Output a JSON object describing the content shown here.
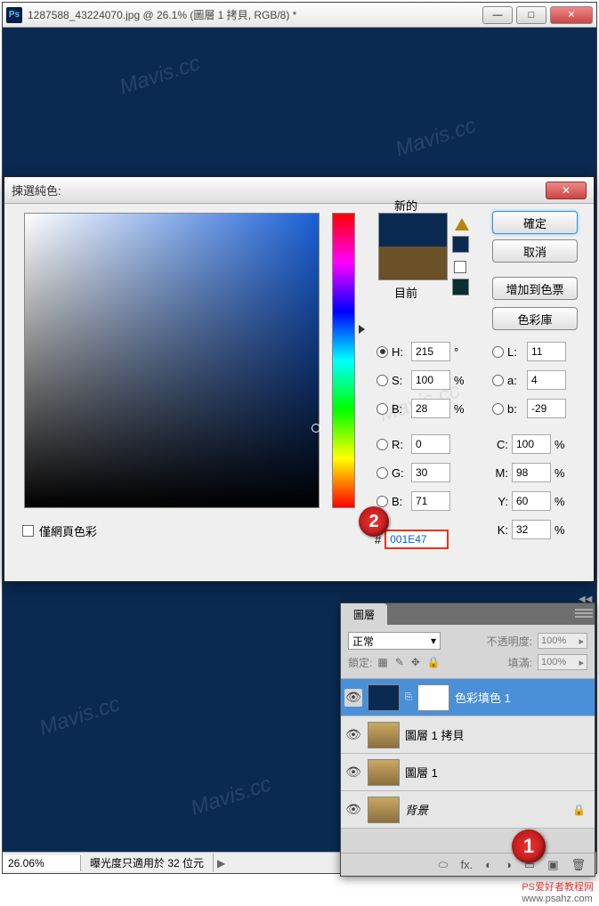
{
  "window": {
    "title": "1287588_43224070.jpg @ 26.1% (圖層 1 拷貝, RGB/8) *",
    "ps_label": "Ps"
  },
  "statusbar": {
    "zoom": "26.06%",
    "info": "曝光度只適用於 32 位元"
  },
  "color_dialog": {
    "title": "揀選純色:",
    "labels": {
      "new": "新的",
      "current": "目前"
    },
    "buttons": {
      "ok": "確定",
      "cancel": "取消",
      "add": "增加到色票",
      "lib": "色彩庫"
    },
    "hsb": {
      "H": "215",
      "S": "100",
      "B": "28"
    },
    "lab": {
      "L": "11",
      "a": "4",
      "b": "-29"
    },
    "rgb": {
      "R": "0",
      "G": "30",
      "B": "71"
    },
    "cmyk": {
      "C": "100",
      "M": "98",
      "Y": "60",
      "K": "32"
    },
    "units": {
      "deg": "°",
      "pct": "%"
    },
    "hex_prefix": "#",
    "hex": "001E47",
    "web_only": "僅網頁色彩"
  },
  "layers": {
    "tab": "圖層",
    "blend_mode": "正常",
    "opacity_label": "不透明度:",
    "opacity": "100%",
    "lock_label": "鎖定:",
    "fill_label": "填滿:",
    "fill": "100%",
    "items": [
      {
        "name": "色彩填色 1",
        "selected": true,
        "thumb": "navy",
        "mask": true
      },
      {
        "name": "圖層 1 拷貝",
        "selected": false,
        "thumb": "lion"
      },
      {
        "name": "圖層 1",
        "selected": false,
        "thumb": "lion"
      },
      {
        "name": "背景",
        "selected": false,
        "thumb": "lion",
        "locked": true,
        "italic": true
      }
    ]
  },
  "markers": {
    "m1": "1",
    "m2": "2"
  },
  "credit": {
    "text1": "PS爱好者教程网",
    "text2": "www.psahz.com"
  }
}
